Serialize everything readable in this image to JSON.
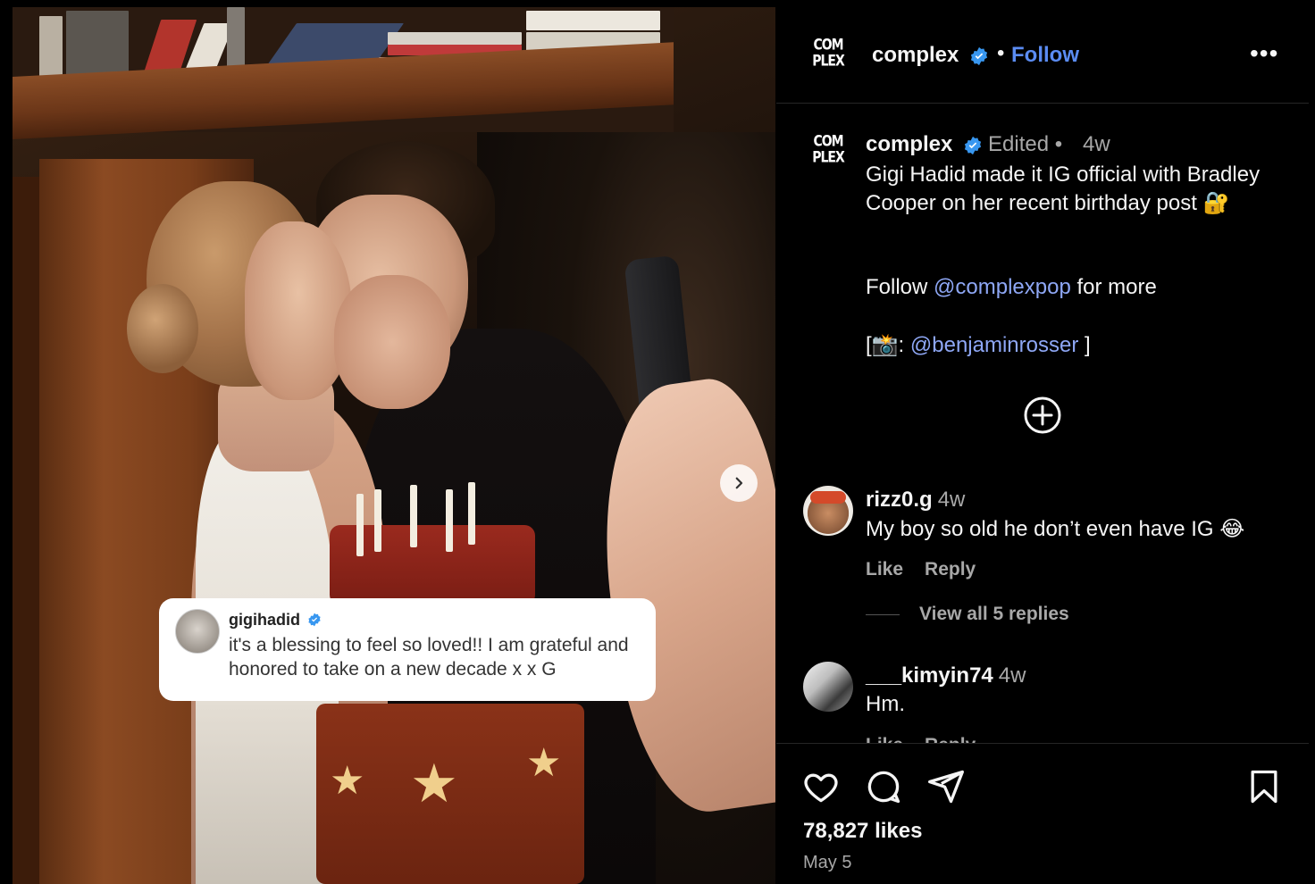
{
  "reply_card": {
    "username": "gigihadid",
    "text": "it's a blessing to feel so loved!! I am grateful and honored to take on a new decade x x G"
  },
  "header": {
    "logo_text_1": "COM",
    "logo_text_2": "PLEX",
    "username": "complex",
    "separator": "•",
    "follow_label": "Follow",
    "more_label": "•••"
  },
  "caption": {
    "username": "complex",
    "edited": "Edited •",
    "time": "4w",
    "body": "Gigi Hadid made it IG official with Bradley Cooper on her recent birthday post 🔐",
    "follow_prefix": "Follow ",
    "follow_mention": "@complexpop",
    "follow_suffix": " for more",
    "credit_prefix": "[📸: ",
    "credit_mention": "@benjaminrosser",
    "credit_suffix": " ]"
  },
  "comments": [
    {
      "username": "rizz0.g",
      "time": "4w",
      "text": "My boy so old he don’t even have IG 😂",
      "like_label": "Like",
      "reply_label": "Reply"
    },
    {
      "username": "___kimyin74",
      "time": "4w",
      "text": "Hm.",
      "like_label": "Like",
      "reply_label": "Reply"
    }
  ],
  "view_replies_label": "View all 5 replies",
  "footer": {
    "likes": "78,827 likes",
    "date": "May 5"
  },
  "colors": {
    "background": "#000000",
    "link_blue": "#5b8cf3",
    "mention_blue": "#8ea7f5",
    "secondary_text": "#a8a8a8",
    "verified_badge": "#3897f0"
  }
}
